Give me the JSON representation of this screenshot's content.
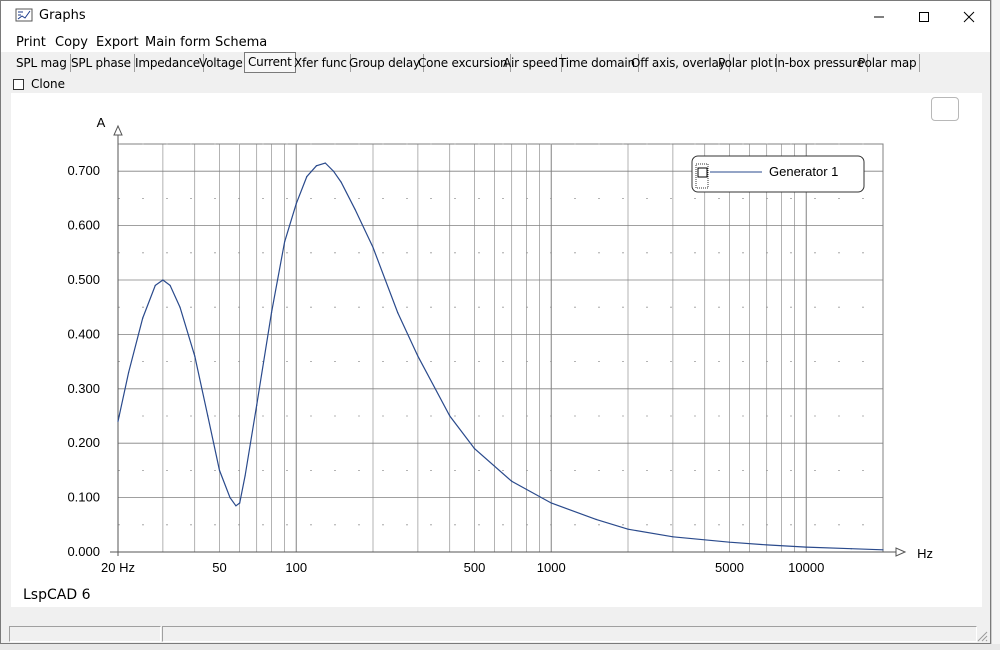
{
  "window": {
    "title": "Graphs",
    "buttons": [
      "minimize",
      "maximize",
      "close"
    ]
  },
  "menu": [
    {
      "label": "Print"
    },
    {
      "label": "Copy"
    },
    {
      "label": "Export"
    },
    {
      "label": "Main form"
    },
    {
      "label": "Schema"
    }
  ],
  "tabs": [
    {
      "label": "SPL mag",
      "active": false
    },
    {
      "label": "SPL phase",
      "active": false
    },
    {
      "label": "Impedance",
      "active": false
    },
    {
      "label": "Voltage",
      "active": false
    },
    {
      "label": "Current",
      "active": true
    },
    {
      "label": "Xfer func",
      "active": false
    },
    {
      "label": "Group delay",
      "active": false
    },
    {
      "label": "Cone excursion",
      "active": false
    },
    {
      "label": "Air speed",
      "active": false
    },
    {
      "label": "Time domain",
      "active": false
    },
    {
      "label": "Off axis, overlay",
      "active": false
    },
    {
      "label": "Polar plot",
      "active": false
    },
    {
      "label": "In-box pressure",
      "active": false
    },
    {
      "label": "Polar map",
      "active": false
    }
  ],
  "clone": {
    "label": "Clone",
    "checked": false
  },
  "footer": {
    "brand": "LspCAD 6"
  },
  "colors": {
    "curve": "#2a4a8c",
    "grid": "#808080",
    "background": "#ffffff"
  },
  "chart_data": {
    "type": "line",
    "title": "",
    "ylabel": "A",
    "xlabel": "Hz",
    "x_scale": "log",
    "xlim": [
      20,
      20000
    ],
    "ylim": [
      0,
      0.75
    ],
    "y_ticks": [
      "0.000",
      "0.100",
      "0.200",
      "0.300",
      "0.400",
      "0.500",
      "0.600",
      "0.700"
    ],
    "x_tick_labels": [
      "20 Hz",
      "50",
      "100",
      "500",
      "1000",
      "5000",
      "10000"
    ],
    "legend": {
      "position": "top-right",
      "entries": [
        "Generator 1"
      ]
    },
    "grid": true,
    "series": [
      {
        "name": "Generator 1",
        "x": [
          20,
          22,
          25,
          28,
          30,
          32,
          35,
          40,
          45,
          50,
          55,
          58,
          60,
          63,
          70,
          80,
          90,
          100,
          110,
          120,
          130,
          140,
          150,
          170,
          200,
          250,
          300,
          400,
          500,
          700,
          1000,
          1500,
          2000,
          3000,
          5000,
          7000,
          10000,
          15000,
          20000
        ],
        "values": [
          0.24,
          0.33,
          0.43,
          0.49,
          0.5,
          0.49,
          0.45,
          0.36,
          0.25,
          0.15,
          0.1,
          0.085,
          0.09,
          0.14,
          0.27,
          0.44,
          0.57,
          0.64,
          0.69,
          0.71,
          0.715,
          0.7,
          0.68,
          0.63,
          0.56,
          0.44,
          0.36,
          0.25,
          0.19,
          0.13,
          0.09,
          0.06,
          0.042,
          0.028,
          0.018,
          0.013,
          0.009,
          0.006,
          0.004
        ]
      }
    ]
  }
}
